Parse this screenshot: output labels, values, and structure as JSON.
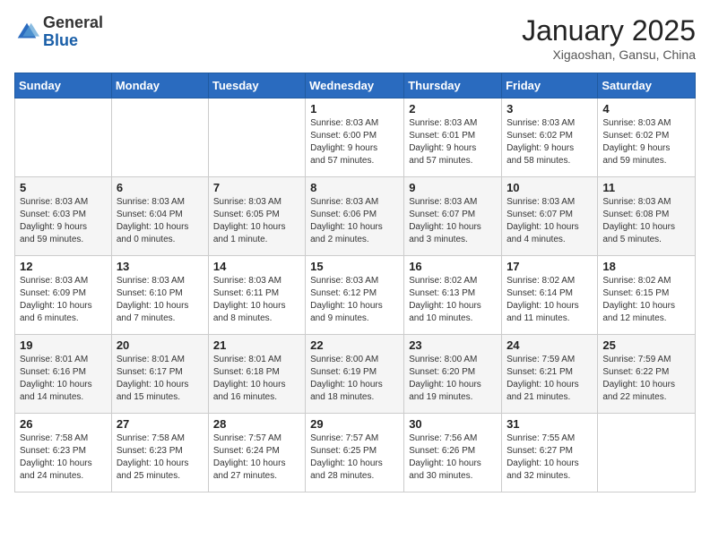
{
  "header": {
    "logo": {
      "general": "General",
      "blue": "Blue"
    },
    "title": "January 2025",
    "location": "Xigaoshan, Gansu, China"
  },
  "weekdays": [
    "Sunday",
    "Monday",
    "Tuesday",
    "Wednesday",
    "Thursday",
    "Friday",
    "Saturday"
  ],
  "weeks": [
    [
      {
        "day": "",
        "info": ""
      },
      {
        "day": "",
        "info": ""
      },
      {
        "day": "",
        "info": ""
      },
      {
        "day": "1",
        "info": "Sunrise: 8:03 AM\nSunset: 6:00 PM\nDaylight: 9 hours\nand 57 minutes."
      },
      {
        "day": "2",
        "info": "Sunrise: 8:03 AM\nSunset: 6:01 PM\nDaylight: 9 hours\nand 57 minutes."
      },
      {
        "day": "3",
        "info": "Sunrise: 8:03 AM\nSunset: 6:02 PM\nDaylight: 9 hours\nand 58 minutes."
      },
      {
        "day": "4",
        "info": "Sunrise: 8:03 AM\nSunset: 6:02 PM\nDaylight: 9 hours\nand 59 minutes."
      }
    ],
    [
      {
        "day": "5",
        "info": "Sunrise: 8:03 AM\nSunset: 6:03 PM\nDaylight: 9 hours\nand 59 minutes."
      },
      {
        "day": "6",
        "info": "Sunrise: 8:03 AM\nSunset: 6:04 PM\nDaylight: 10 hours\nand 0 minutes."
      },
      {
        "day": "7",
        "info": "Sunrise: 8:03 AM\nSunset: 6:05 PM\nDaylight: 10 hours\nand 1 minute."
      },
      {
        "day": "8",
        "info": "Sunrise: 8:03 AM\nSunset: 6:06 PM\nDaylight: 10 hours\nand 2 minutes."
      },
      {
        "day": "9",
        "info": "Sunrise: 8:03 AM\nSunset: 6:07 PM\nDaylight: 10 hours\nand 3 minutes."
      },
      {
        "day": "10",
        "info": "Sunrise: 8:03 AM\nSunset: 6:07 PM\nDaylight: 10 hours\nand 4 minutes."
      },
      {
        "day": "11",
        "info": "Sunrise: 8:03 AM\nSunset: 6:08 PM\nDaylight: 10 hours\nand 5 minutes."
      }
    ],
    [
      {
        "day": "12",
        "info": "Sunrise: 8:03 AM\nSunset: 6:09 PM\nDaylight: 10 hours\nand 6 minutes."
      },
      {
        "day": "13",
        "info": "Sunrise: 8:03 AM\nSunset: 6:10 PM\nDaylight: 10 hours\nand 7 minutes."
      },
      {
        "day": "14",
        "info": "Sunrise: 8:03 AM\nSunset: 6:11 PM\nDaylight: 10 hours\nand 8 minutes."
      },
      {
        "day": "15",
        "info": "Sunrise: 8:03 AM\nSunset: 6:12 PM\nDaylight: 10 hours\nand 9 minutes."
      },
      {
        "day": "16",
        "info": "Sunrise: 8:02 AM\nSunset: 6:13 PM\nDaylight: 10 hours\nand 10 minutes."
      },
      {
        "day": "17",
        "info": "Sunrise: 8:02 AM\nSunset: 6:14 PM\nDaylight: 10 hours\nand 11 minutes."
      },
      {
        "day": "18",
        "info": "Sunrise: 8:02 AM\nSunset: 6:15 PM\nDaylight: 10 hours\nand 12 minutes."
      }
    ],
    [
      {
        "day": "19",
        "info": "Sunrise: 8:01 AM\nSunset: 6:16 PM\nDaylight: 10 hours\nand 14 minutes."
      },
      {
        "day": "20",
        "info": "Sunrise: 8:01 AM\nSunset: 6:17 PM\nDaylight: 10 hours\nand 15 minutes."
      },
      {
        "day": "21",
        "info": "Sunrise: 8:01 AM\nSunset: 6:18 PM\nDaylight: 10 hours\nand 16 minutes."
      },
      {
        "day": "22",
        "info": "Sunrise: 8:00 AM\nSunset: 6:19 PM\nDaylight: 10 hours\nand 18 minutes."
      },
      {
        "day": "23",
        "info": "Sunrise: 8:00 AM\nSunset: 6:20 PM\nDaylight: 10 hours\nand 19 minutes."
      },
      {
        "day": "24",
        "info": "Sunrise: 7:59 AM\nSunset: 6:21 PM\nDaylight: 10 hours\nand 21 minutes."
      },
      {
        "day": "25",
        "info": "Sunrise: 7:59 AM\nSunset: 6:22 PM\nDaylight: 10 hours\nand 22 minutes."
      }
    ],
    [
      {
        "day": "26",
        "info": "Sunrise: 7:58 AM\nSunset: 6:23 PM\nDaylight: 10 hours\nand 24 minutes."
      },
      {
        "day": "27",
        "info": "Sunrise: 7:58 AM\nSunset: 6:23 PM\nDaylight: 10 hours\nand 25 minutes."
      },
      {
        "day": "28",
        "info": "Sunrise: 7:57 AM\nSunset: 6:24 PM\nDaylight: 10 hours\nand 27 minutes."
      },
      {
        "day": "29",
        "info": "Sunrise: 7:57 AM\nSunset: 6:25 PM\nDaylight: 10 hours\nand 28 minutes."
      },
      {
        "day": "30",
        "info": "Sunrise: 7:56 AM\nSunset: 6:26 PM\nDaylight: 10 hours\nand 30 minutes."
      },
      {
        "day": "31",
        "info": "Sunrise: 7:55 AM\nSunset: 6:27 PM\nDaylight: 10 hours\nand 32 minutes."
      },
      {
        "day": "",
        "info": ""
      }
    ]
  ]
}
